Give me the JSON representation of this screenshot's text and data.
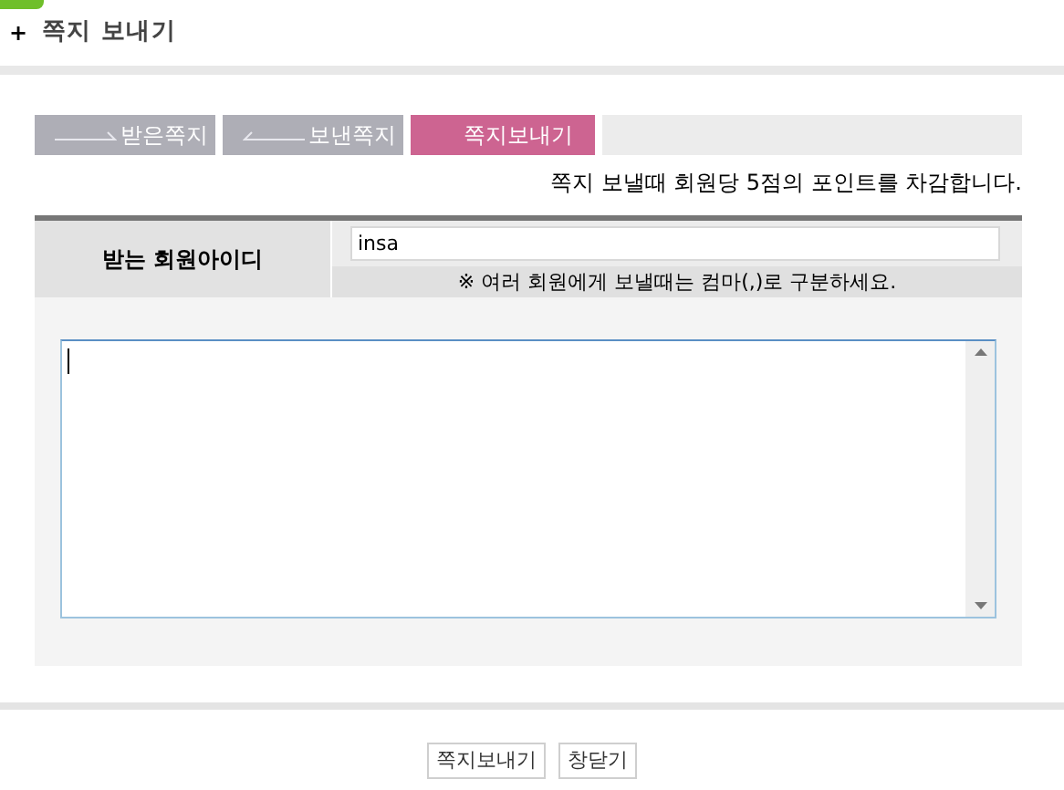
{
  "header": {
    "bullet": "+",
    "title": "쪽지 보내기"
  },
  "tabs": [
    {
      "label": "받은쪽지",
      "selected": false,
      "kind": "arrowright"
    },
    {
      "label": "보낸쪽지",
      "selected": false,
      "kind": "arrowleft"
    },
    {
      "label": "쪽지보내기",
      "selected": true,
      "kind": "plain"
    }
  ],
  "notice": "쪽지 보낼때 회원당 5점의 포인트를 차감합니다.",
  "form": {
    "recipient_label": "받는 회원아이디",
    "recipient_value": "insa",
    "hint": "※ 여러 회원에게 보낼때는 컴마(,)로 구분하세요."
  },
  "buttons": [
    "쪽지보내기",
    "창닫기"
  ]
}
